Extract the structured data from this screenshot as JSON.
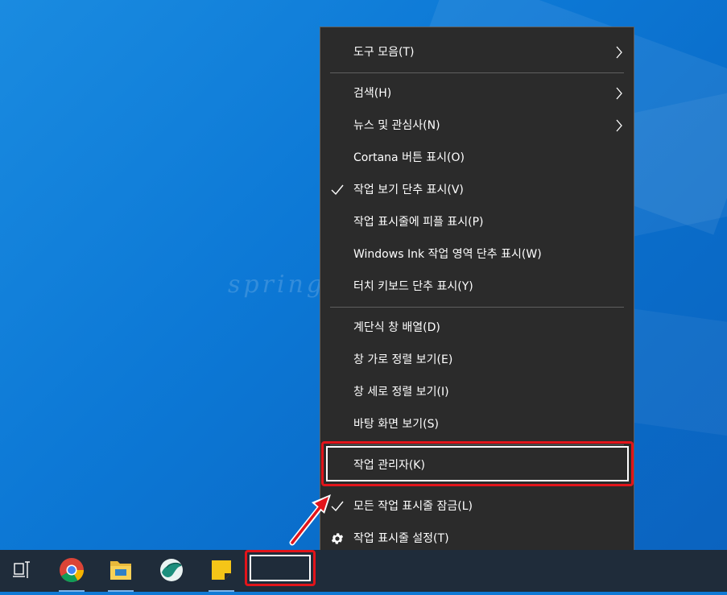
{
  "desktop": {
    "watermark": "springi"
  },
  "context_menu": {
    "items": [
      {
        "label": "도구 모음(T)",
        "submenu": true
      },
      {
        "label": "검색(H)",
        "submenu": true
      },
      {
        "label": "뉴스 및 관심사(N)",
        "submenu": true
      },
      {
        "label": "Cortana 버튼 표시(O)"
      },
      {
        "label": "작업 보기 단추 표시(V)",
        "checked": true
      },
      {
        "label": "작업 표시줄에 피플 표시(P)"
      },
      {
        "label": "Windows Ink 작업 영역 단추 표시(W)"
      },
      {
        "label": "터치 키보드 단추 표시(Y)"
      },
      {
        "label": "계단식 창 배열(D)"
      },
      {
        "label": "창 가로 정렬 보기(E)"
      },
      {
        "label": "창 세로 정렬 보기(I)"
      },
      {
        "label": "바탕 화면 보기(S)"
      },
      {
        "label": "작업 관리자(K)",
        "highlighted": true
      },
      {
        "label": "모든 작업 표시줄 잠금(L)",
        "checked": true
      },
      {
        "label": "작업 표시줄 설정(T)",
        "icon": "gear-icon"
      }
    ]
  },
  "taskbar": {
    "buttons": [
      {
        "name": "task-view-icon"
      },
      {
        "name": "chrome-icon"
      },
      {
        "name": "file-explorer-icon"
      },
      {
        "name": "whale-browser-icon"
      },
      {
        "name": "sticky-notes-icon"
      }
    ]
  },
  "colors": {
    "menu_bg": "#2b2b2b",
    "menu_text": "#ffffff",
    "highlight": "#e2141a",
    "taskbar_bg": "#1f2c3a",
    "desktop_bg": "#0f7ad6"
  }
}
